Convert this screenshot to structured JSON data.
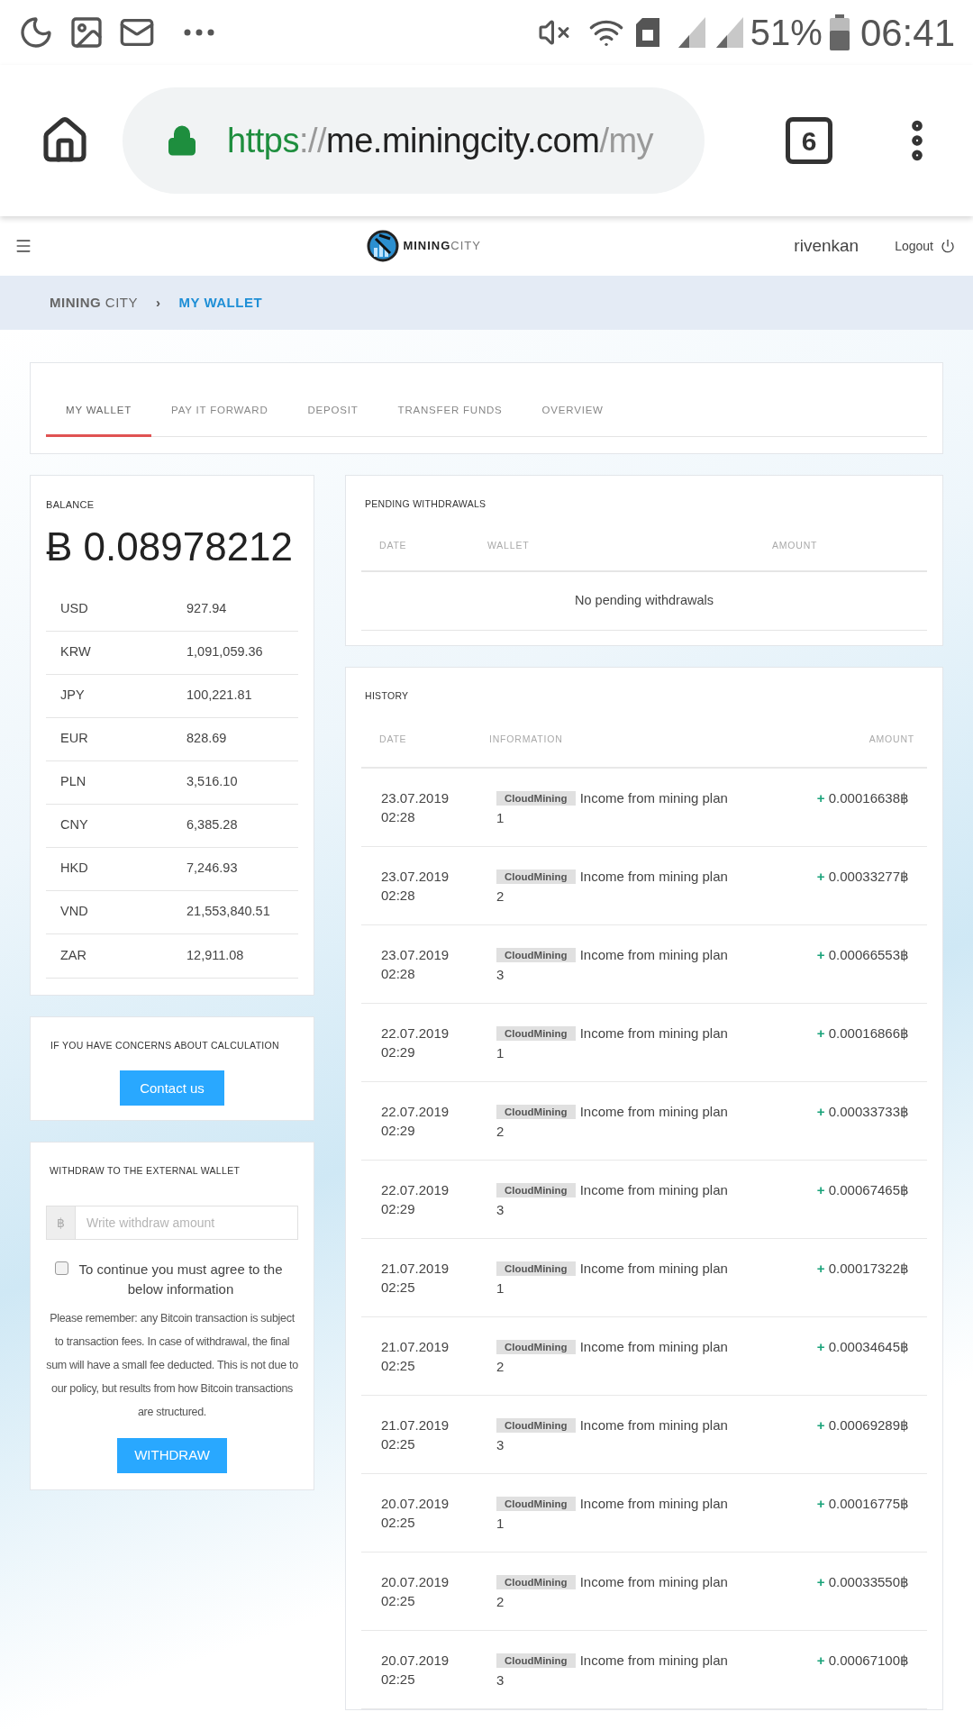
{
  "status_bar": {
    "battery": "51%",
    "time": "06:41"
  },
  "browser": {
    "scheme": "https",
    "separator": "://",
    "host": "me.miningcity.com",
    "path": "/my",
    "tab_count": "6"
  },
  "header": {
    "logo_first": "MINING",
    "logo_second": "CITY",
    "username": "rivenkan",
    "logout": "Logout"
  },
  "breadcrumb": {
    "separator": "›",
    "items": [
      {
        "first": "MINING",
        "second": "CITY",
        "selected": false
      },
      {
        "first": "MY WALLET",
        "selected": true
      }
    ]
  },
  "tabs": [
    {
      "label": "MY WALLET",
      "selected": true
    },
    {
      "label": "PAY IT FORWARD",
      "selected": false
    },
    {
      "label": "DEPOSIT",
      "selected": false
    },
    {
      "label": "TRANSFER FUNDS",
      "selected": false
    },
    {
      "label": "OVERVIEW",
      "selected": false
    }
  ],
  "balance": {
    "title": "BALANCE",
    "symbol": "Ƀ",
    "amount": "0.08978212",
    "currencies": [
      {
        "code": "USD",
        "value": "927.94"
      },
      {
        "code": "KRW",
        "value": "1,091,059.36"
      },
      {
        "code": "JPY",
        "value": "100,221.81"
      },
      {
        "code": "EUR",
        "value": "828.69"
      },
      {
        "code": "PLN",
        "value": "3,516.10"
      },
      {
        "code": "CNY",
        "value": "6,385.28"
      },
      {
        "code": "HKD",
        "value": "7,246.93"
      },
      {
        "code": "VND",
        "value": "21,553,840.51"
      },
      {
        "code": "ZAR",
        "value": "12,911.08"
      }
    ]
  },
  "concerns": {
    "title": "IF YOU HAVE CONCERNS ABOUT CALCULATION",
    "button": "Contact us"
  },
  "withdraw": {
    "title": "WITHDRAW TO THE EXTERNAL WALLET",
    "addon": "฿",
    "placeholder": "Write withdraw amount",
    "agree_checked": false,
    "agree_label": "To continue you must agree to the below information",
    "notice": "Please remember: any Bitcoin transaction is subject to transaction fees. In case of withdrawal, the final sum will have a small fee deducted. This is not due to our policy, but results from how Bitcoin transactions are structured.",
    "button": "WITHDRAW"
  },
  "pending": {
    "title": "PENDING WITHDRAWALS",
    "columns": [
      "DATE",
      "WALLET",
      "AMOUNT"
    ],
    "empty": "No pending withdrawals"
  },
  "history": {
    "title": "HISTORY",
    "columns": [
      "DATE",
      "INFORMATION",
      "AMOUNT"
    ],
    "rows": [
      {
        "date": "23.07.2019",
        "time": "02:28",
        "tag": "CloudMining",
        "info": "Income from mining plan 1",
        "sign": "+",
        "amount": "0.00016638฿"
      },
      {
        "date": "23.07.2019",
        "time": "02:28",
        "tag": "CloudMining",
        "info": "Income from mining plan 2",
        "sign": "+",
        "amount": "0.00033277฿"
      },
      {
        "date": "23.07.2019",
        "time": "02:28",
        "tag": "CloudMining",
        "info": "Income from mining plan 3",
        "sign": "+",
        "amount": "0.00066553฿"
      },
      {
        "date": "22.07.2019",
        "time": "02:29",
        "tag": "CloudMining",
        "info": "Income from mining plan 1",
        "sign": "+",
        "amount": "0.00016866฿"
      },
      {
        "date": "22.07.2019",
        "time": "02:29",
        "tag": "CloudMining",
        "info": "Income from mining plan 2",
        "sign": "+",
        "amount": "0.00033733฿"
      },
      {
        "date": "22.07.2019",
        "time": "02:29",
        "tag": "CloudMining",
        "info": "Income from mining plan 3",
        "sign": "+",
        "amount": "0.00067465฿"
      },
      {
        "date": "21.07.2019",
        "time": "02:25",
        "tag": "CloudMining",
        "info": "Income from mining plan 1",
        "sign": "+",
        "amount": "0.00017322฿"
      },
      {
        "date": "21.07.2019",
        "time": "02:25",
        "tag": "CloudMining",
        "info": "Income from mining plan 2",
        "sign": "+",
        "amount": "0.00034645฿"
      },
      {
        "date": "21.07.2019",
        "time": "02:25",
        "tag": "CloudMining",
        "info": "Income from mining plan 3",
        "sign": "+",
        "amount": "0.00069289฿"
      },
      {
        "date": "20.07.2019",
        "time": "02:25",
        "tag": "CloudMining",
        "info": "Income from mining plan 1",
        "sign": "+",
        "amount": "0.00016775฿"
      },
      {
        "date": "20.07.2019",
        "time": "02:25",
        "tag": "CloudMining",
        "info": "Income from mining plan 2",
        "sign": "+",
        "amount": "0.00033550฿"
      },
      {
        "date": "20.07.2019",
        "time": "02:25",
        "tag": "CloudMining",
        "info": "Income from mining plan 3",
        "sign": "+",
        "amount": "0.00067100฿"
      }
    ]
  }
}
